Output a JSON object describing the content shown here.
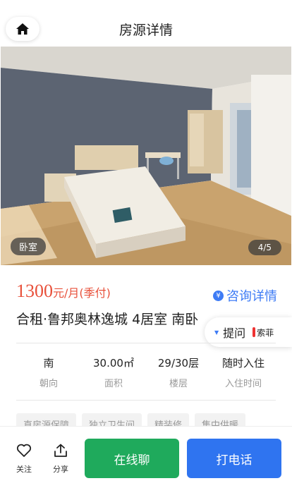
{
  "header": {
    "title": "房源详情",
    "home_icon": "home-icon"
  },
  "photo": {
    "room_tag": "卧室",
    "counter": "4/5"
  },
  "listing": {
    "price": "1300",
    "price_unit": "元/月(季付)",
    "consult_label": "咨询详情",
    "name": "合租·鲁邦奥林逸城 4居室 南卧"
  },
  "ask": {
    "label": "提问",
    "brand": "索菲"
  },
  "stats": [
    {
      "value": "南",
      "label": "朝向"
    },
    {
      "value": "30.00㎡",
      "label": "面积"
    },
    {
      "value": "29/30层",
      "label": "楼层"
    },
    {
      "value": "随时入住",
      "label": "入住时间"
    }
  ],
  "tags": [
    "直房源保障",
    "独立卫生间",
    "精装修",
    "集中供暖"
  ],
  "bottom": {
    "follow_label": "关注",
    "share_label": "分享",
    "chat_label": "在线聊",
    "call_label": "打电话"
  },
  "colors": {
    "price": "#e8503a",
    "accent": "#3d7bf5",
    "chat": "#1faa5c",
    "call": "#2f74f0"
  }
}
